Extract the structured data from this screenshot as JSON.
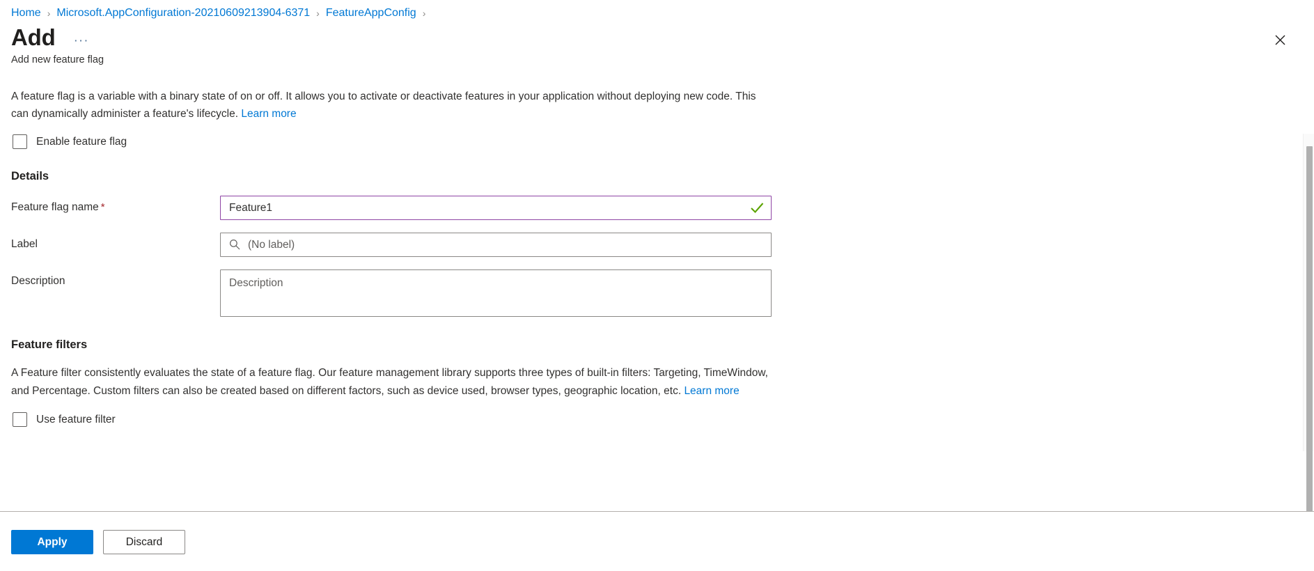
{
  "breadcrumb": {
    "items": [
      {
        "label": "Home"
      },
      {
        "label": "Microsoft.AppConfiguration-20210609213904-6371"
      },
      {
        "label": "FeatureAppConfig"
      }
    ],
    "separator": "›"
  },
  "header": {
    "title": "Add",
    "subtitle": "Add new feature flag",
    "ellipsis_label": "···",
    "close_label": "✕"
  },
  "intro": {
    "text": "A feature flag is a variable with a binary state of on or off. It allows you to activate or deactivate features in your application without deploying new code. This can dynamically administer a feature's lifecycle. ",
    "learn_more": "Learn more"
  },
  "enable_flag": {
    "label": "Enable feature flag",
    "checked": false
  },
  "details": {
    "heading": "Details",
    "name_field": {
      "label": "Feature flag name",
      "required_marker": "*",
      "value": "Feature1",
      "placeholder": "",
      "valid": true,
      "focus_border_color": "#8e44a4",
      "check_color": "#5ba300"
    },
    "label_field": {
      "label": "Label",
      "value": "",
      "placeholder": "(No label)",
      "icon": "search-icon"
    },
    "description_field": {
      "label": "Description",
      "value": "",
      "placeholder": "Description"
    }
  },
  "feature_filters": {
    "heading": "Feature filters",
    "text": "A Feature filter consistently evaluates the state of a feature flag. Our feature management library supports three types of built-in filters: Targeting, TimeWindow, and Percentage. Custom filters can also be created based on different factors, such as device used, browser types, geographic location, etc. ",
    "learn_more": "Learn more",
    "use_filter": {
      "label": "Use feature filter",
      "checked": false
    }
  },
  "footer": {
    "apply_label": "Apply",
    "discard_label": "Discard"
  },
  "colors": {
    "accent": "#0078d4",
    "link": "#0078d4",
    "required": "#a4262c",
    "valid_check": "#5ba300",
    "focus_border": "#8e44a4"
  }
}
